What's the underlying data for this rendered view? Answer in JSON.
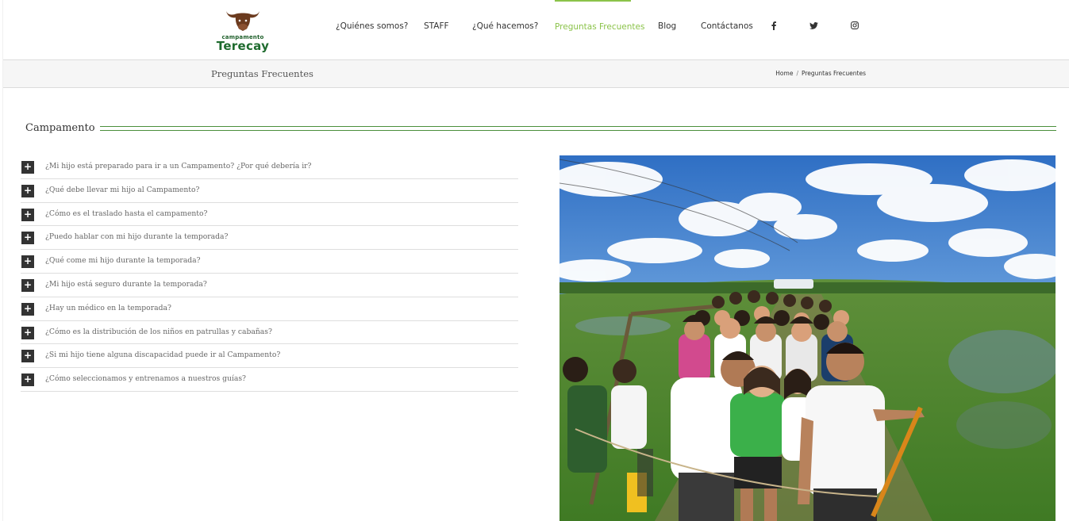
{
  "brand": {
    "logo_small": "campamento",
    "logo_big": "Terecay",
    "colors": {
      "accent": "#8bc34a",
      "brand_green": "#1e6b2e",
      "logo_brown": "#6b3a1e"
    }
  },
  "nav": {
    "items": [
      {
        "label": "¿Quiénes somos?"
      },
      {
        "label": "STAFF"
      },
      {
        "label": "¿Qué hacemos?"
      },
      {
        "label": "Preguntas Frecuentes",
        "active": true
      },
      {
        "label": "Blog"
      },
      {
        "label": "Contáctanos"
      }
    ],
    "social": [
      {
        "icon": "facebook-icon",
        "glyph": "f"
      },
      {
        "icon": "twitter-icon",
        "glyph": "t"
      },
      {
        "icon": "instagram-icon",
        "glyph": "ig"
      }
    ]
  },
  "titlebar": {
    "title": "Preguntas Frecuentes",
    "breadcrumb": {
      "home": "Home",
      "separator": "/",
      "current": "Preguntas Frecuentes"
    }
  },
  "section": {
    "title": "Campamento"
  },
  "faq": {
    "toggle_symbol": "+",
    "items": [
      "¿Mi hijo está preparado para ir a un Campamento? ¿Por qué debería ir?",
      "¿Qué debe llevar mi hijo al Campamento?",
      "¿Cómo es el traslado hasta el campamento?",
      "¿Puedo hablar con mi hijo durante la temporada?",
      "¿Qué come mi hijo durante la temporada?",
      "¿Mi hijo está seguro durante la temporada?",
      "¿Hay un médico en la temporada?",
      "¿Cómo es la distribución de los niños en patrullas y cabañas?",
      "¿Si mi hijo tiene alguna discapacidad puede ir al Campamento?",
      "¿Cómo seleccionamos y entrenamos a nuestros guías?"
    ]
  }
}
